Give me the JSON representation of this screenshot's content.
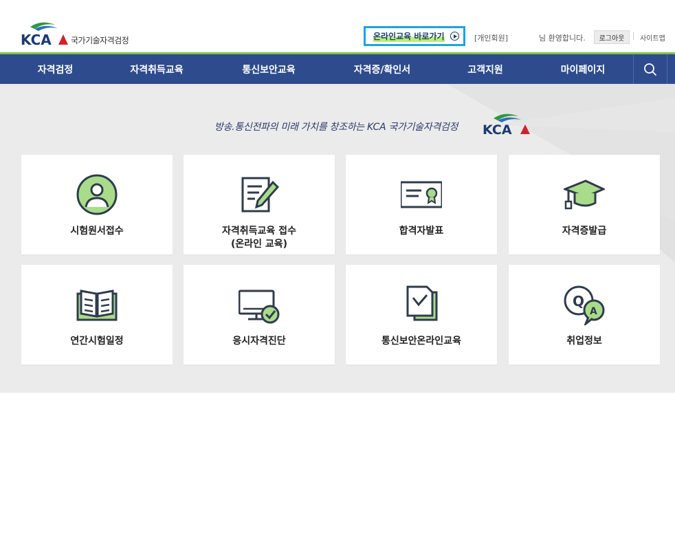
{
  "header": {
    "logo_name": "국가기술자격검정",
    "online_button": "온라인교육 바로가기",
    "member_type": "[개인회원]",
    "welcome": "님 환영합니다.",
    "logout": "로그아웃",
    "sitemap": "사이트맵"
  },
  "nav": {
    "items": [
      "자격검정",
      "자격취득교육",
      "통신보안교육",
      "자격증/확인서",
      "고객지원",
      "마이페이지"
    ]
  },
  "main": {
    "slogan": "방송.통신전파의 미래 가치를 창조하는 KCA 국가기술자격검정",
    "tiles": [
      {
        "label": "시험원서접수",
        "icon": "user-circle-icon"
      },
      {
        "label": "자격취득교육 접수",
        "label2": "(온라인 교육)",
        "icon": "document-pencil-icon"
      },
      {
        "label": "합격자발표",
        "icon": "certificate-icon"
      },
      {
        "label": "자격증발급",
        "icon": "graduation-cap-icon"
      },
      {
        "label": "연간시험일정",
        "icon": "open-book-icon"
      },
      {
        "label": "응시자격진단",
        "icon": "monitor-check-icon"
      },
      {
        "label": "통신보안온라인교육",
        "icon": "document-check-icon"
      },
      {
        "label": "취업정보",
        "icon": "qa-bubble-icon"
      }
    ]
  },
  "colors": {
    "nav_bg": "#2e4b8e",
    "accent_green": "#7cc24a",
    "icon_dark": "#2f3b4d",
    "icon_fill": "#a9dc8a",
    "highlight_border": "#1aa3e8"
  }
}
